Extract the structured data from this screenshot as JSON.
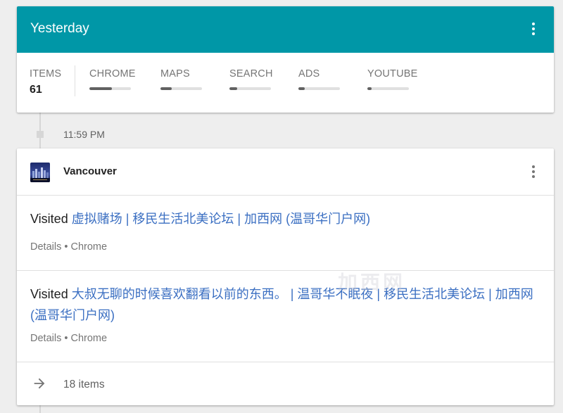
{
  "summary": {
    "title": "Yesterday",
    "items_label": "ITEMS",
    "items_count": "61",
    "categories": [
      {
        "label": "CHROME",
        "fraction": 0.55
      },
      {
        "label": "MAPS",
        "fraction": 0.27
      },
      {
        "label": "SEARCH",
        "fraction": 0.18
      },
      {
        "label": "ADS",
        "fraction": 0.15
      },
      {
        "label": "YOUTUBE",
        "fraction": 0.1
      }
    ],
    "accent_color": "#0097a7"
  },
  "timeline": {
    "time": "11:59 PM"
  },
  "visit": {
    "place": "Vancouver",
    "entries": [
      {
        "prefix": "Visited",
        "title": "虚拟赌场 | 移民生活北美论坛 | 加西网 (温哥华门户网)",
        "details": "Details",
        "separator": "•",
        "source": "Chrome"
      },
      {
        "prefix": "Visited",
        "title": "大叔无聊的时候喜欢翻看以前的东西。 | 温哥华不眠夜 | 移民生活北美论坛 | 加西网 (温哥华门户网)",
        "details": "Details",
        "separator": "•",
        "source": "Chrome"
      }
    ],
    "more_label": "18 items",
    "link_color": "#3b6fc2"
  },
  "watermark": "加西网"
}
